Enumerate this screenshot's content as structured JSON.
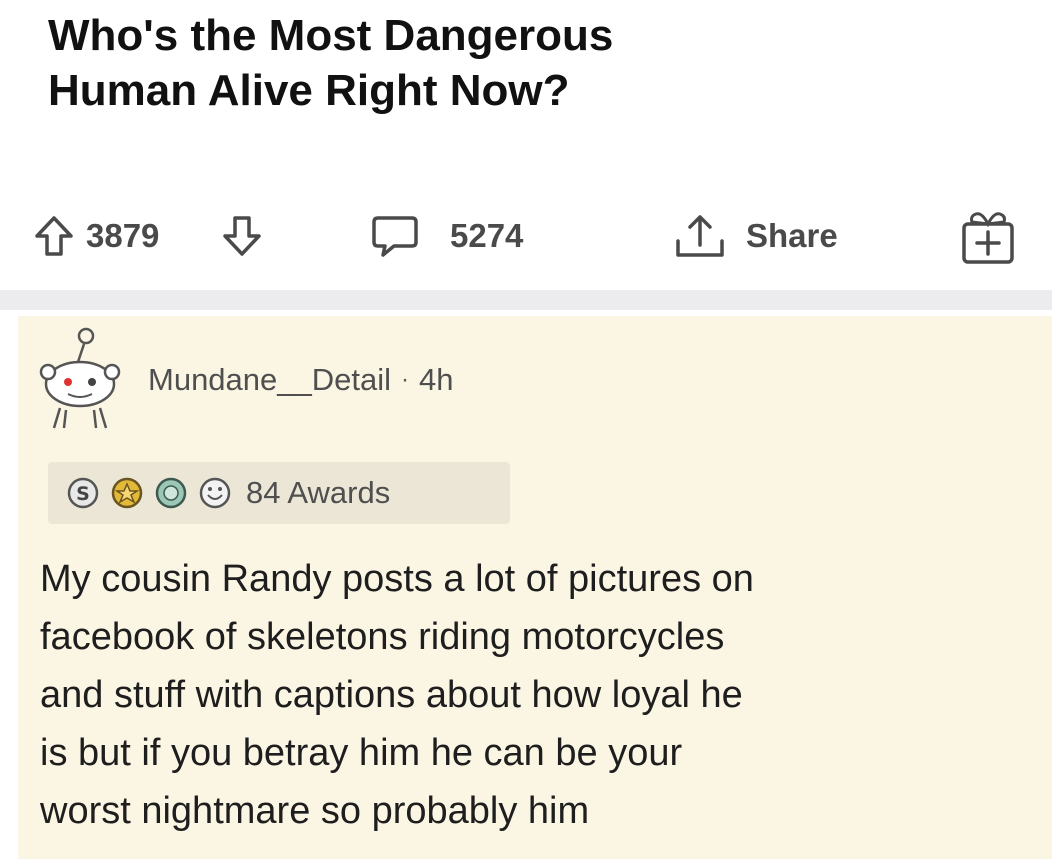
{
  "post": {
    "title_lines": [
      "Who's the Most Dangerous",
      "Human Alive Right Now?"
    ],
    "upvotes": "3879",
    "comments": "5274",
    "share_label": "Share",
    "icons": {
      "upvote": "upvote-arrow-icon",
      "downvote": "downvote-arrow-icon",
      "comment": "comment-bubble-icon",
      "share": "share-upload-icon",
      "award": "add-award-gift-icon"
    }
  },
  "comment": {
    "username": "Mundane__Detail",
    "separator": "·",
    "time": "4h",
    "awards_label": "84 Awards",
    "award_icons": [
      "silver-award-icon",
      "gold-award-icon",
      "helpful-award-icon",
      "wholesome-award-icon"
    ],
    "body_lines": [
      "My cousin Randy posts a lot of pictures on",
      "facebook of skeletons riding motorcycles",
      "and stuff with captions about how loyal he",
      "is but if you betray him he can be your",
      "worst nightmare so probably him"
    ]
  },
  "colors": {
    "comment_background": "#fbf6e4",
    "awards_background": "#ebe6d5",
    "divider": "#ececef",
    "icon_gray": "#4a4a4a"
  }
}
